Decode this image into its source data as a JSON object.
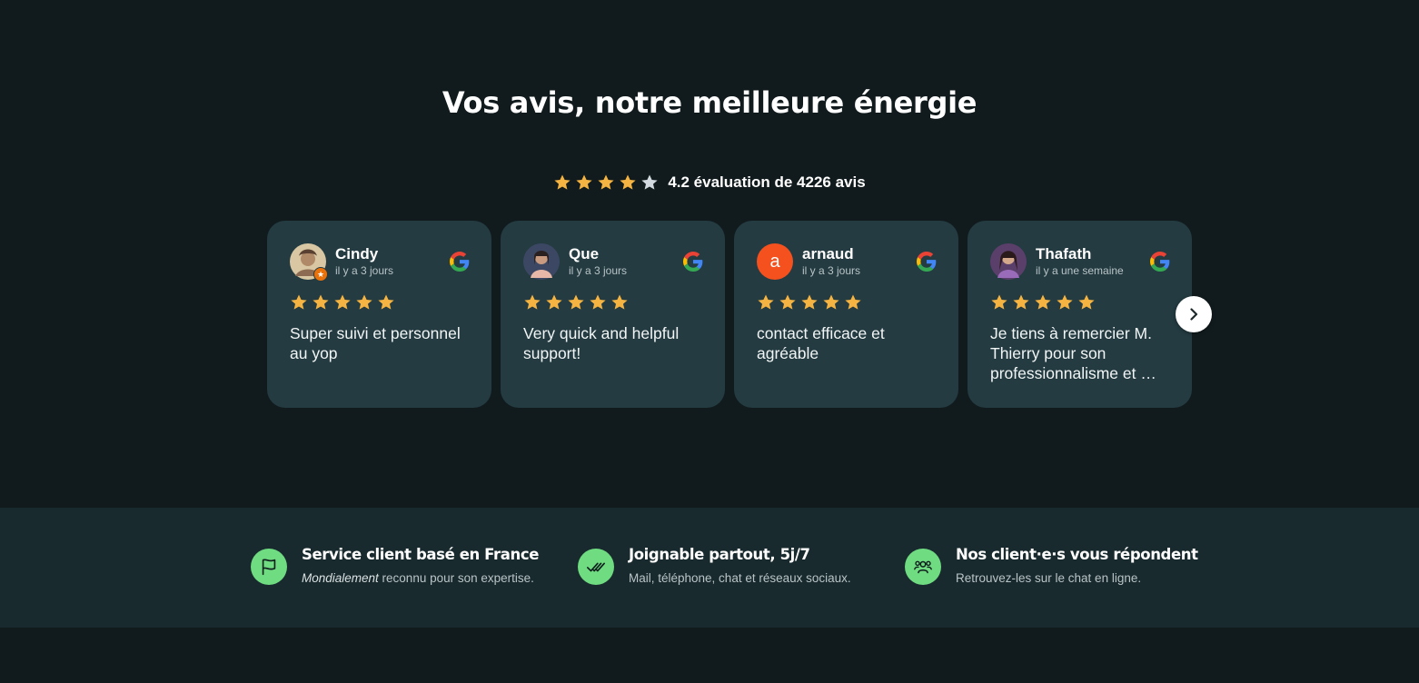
{
  "heading": "Vos avis, notre meilleure énergie",
  "summary": {
    "rating": 4.2,
    "stars_filled": 4,
    "stars_total": 5,
    "text": "4.2 évaluation de 4226 avis"
  },
  "reviews": [
    {
      "name": "Cindy",
      "time": "il y a 3 jours",
      "stars": 5,
      "text": "Super suivi et personnel au yop",
      "avatar_type": "photo",
      "avatar_color": "#c9b08a",
      "source_icon": "google-icon"
    },
    {
      "name": "Que",
      "time": "il y a 3 jours",
      "stars": 5,
      "text": "Very quick and helpful support!",
      "avatar_type": "photo",
      "avatar_color": "#4a5570",
      "source_icon": "google-icon"
    },
    {
      "name": "arnaud",
      "time": "il y a 3 jours",
      "stars": 5,
      "text": "contact efficace et agréable",
      "avatar_type": "letter",
      "avatar_letter": "a",
      "avatar_color": "#f4511e",
      "source_icon": "google-icon"
    },
    {
      "name": "Thafath",
      "time": "il y a une semaine",
      "stars": 5,
      "text": "Je tiens à remercier M. Thierry pour son professionnalisme et …",
      "avatar_type": "photo",
      "avatar_color": "#6b4a7a",
      "source_icon": "google-icon"
    }
  ],
  "carousel": {
    "next_icon": "chevron-right-icon"
  },
  "features": [
    {
      "icon": "flag-icon",
      "title": "Service client basé en France",
      "sub_em": "Mondialement",
      "sub": " reconnu pour son expertise."
    },
    {
      "icon": "double-check-icon",
      "title": "Joignable partout, 5j/7",
      "sub_em": "",
      "sub": "Mail, téléphone, chat et réseaux sociaux."
    },
    {
      "icon": "users-icon",
      "title": "Nos client·e·s vous répondent",
      "sub_em": "",
      "sub": "Retrouvez-les sur le chat en ligne."
    }
  ],
  "colors": {
    "background": "#111b1d",
    "card": "#233b41",
    "features_band": "#182a2e",
    "star": "#f5b342",
    "star_empty": "#d4dbe0",
    "accent_green": "#6fdc81"
  }
}
